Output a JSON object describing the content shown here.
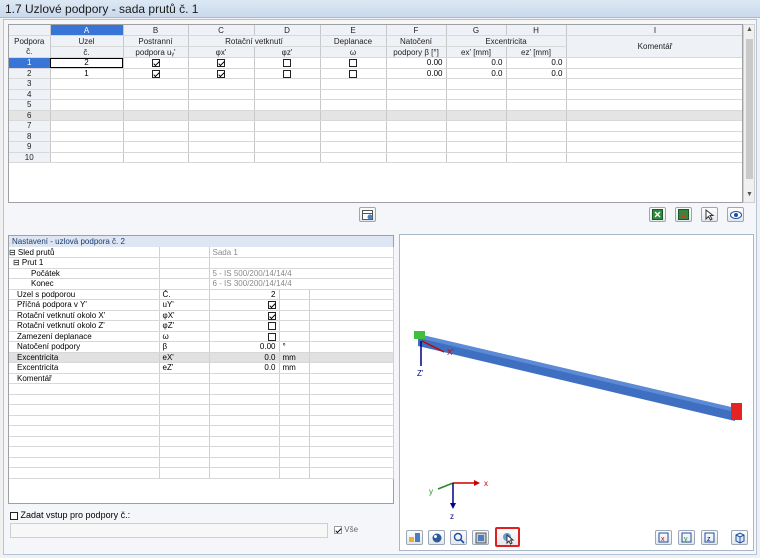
{
  "title": "1.7 Uzlové podpory - sada prutů č. 1",
  "grid": {
    "letters": [
      "A",
      "B",
      "C",
      "D",
      "E",
      "F",
      "G",
      "H",
      "I"
    ],
    "headers1": [
      "Podpora",
      "Uzel",
      "Postranní",
      "Rotační vetknutí",
      "Deplanace",
      "Natočení",
      "Excentricita",
      "Komentář"
    ],
    "headers2": [
      "č.",
      "č.",
      "podpora uᵧ'",
      "φx'",
      "φz'",
      "ω",
      "podpory β [°]",
      "ex' [mm]",
      "ez' [mm]"
    ],
    "rows": [
      {
        "num": "1",
        "uzel": "2",
        "lat": true,
        "rx": true,
        "rz": false,
        "dep": false,
        "beta": "0.00",
        "ex": "0.0",
        "ez": "0.0"
      },
      {
        "num": "2",
        "uzel": "1",
        "lat": true,
        "rx": true,
        "rz": false,
        "dep": false,
        "beta": "0.00",
        "ex": "0.0",
        "ez": "0.0"
      },
      {
        "num": "3"
      },
      {
        "num": "4"
      },
      {
        "num": "5"
      },
      {
        "num": "6"
      },
      {
        "num": "7"
      },
      {
        "num": "8"
      },
      {
        "num": "9"
      },
      {
        "num": "10"
      }
    ]
  },
  "settings": {
    "header": "Nastavení - uzlová podpora č. 2",
    "rows": [
      {
        "label": "⊟ Sled prutů",
        "sym": "",
        "val": "Sada 1",
        "unit": ""
      },
      {
        "label": "⊟ Prut 1",
        "sym": "",
        "val": "",
        "unit": ""
      },
      {
        "label": "Počátek",
        "sym": "",
        "val": "5 - IS 500/200/14/14/4",
        "unit": ""
      },
      {
        "label": "Konec",
        "sym": "",
        "val": "6 - IS 300/200/14/14/4",
        "unit": ""
      },
      {
        "label": "Uzel s podporou",
        "sym": "Č.",
        "val": "2",
        "unit": ""
      },
      {
        "label": "Příčná podpora v Y'",
        "sym": "uY'",
        "val": "",
        "unit": ""
      },
      {
        "label": "Rotační vetknutí okolo X'",
        "sym": "φX'",
        "val": "",
        "unit": ""
      },
      {
        "label": "Rotační vetknutí okolo Z'",
        "sym": "φZ'",
        "val": "",
        "unit": ""
      },
      {
        "label": "Zamezení deplanace",
        "sym": "ω",
        "val": "",
        "unit": ""
      },
      {
        "label": "Natočení podpory",
        "sym": "β",
        "val": "0.00",
        "unit": "°"
      },
      {
        "label": "Excentricita",
        "sym": "eX'",
        "val": "0.0",
        "unit": "mm"
      },
      {
        "label": "Excentricita",
        "sym": "eZ'",
        "val": "0.0",
        "unit": "mm"
      },
      {
        "label": "Komentář",
        "sym": "",
        "val": "",
        "unit": ""
      }
    ]
  },
  "footer": {
    "input_label": "Zadat vstup pro podpory č.:",
    "all_label": "Vše"
  },
  "axes": {
    "x": "x",
    "y": "y",
    "z": "z",
    "x_beam": "X'",
    "z_beam": "Z'"
  }
}
